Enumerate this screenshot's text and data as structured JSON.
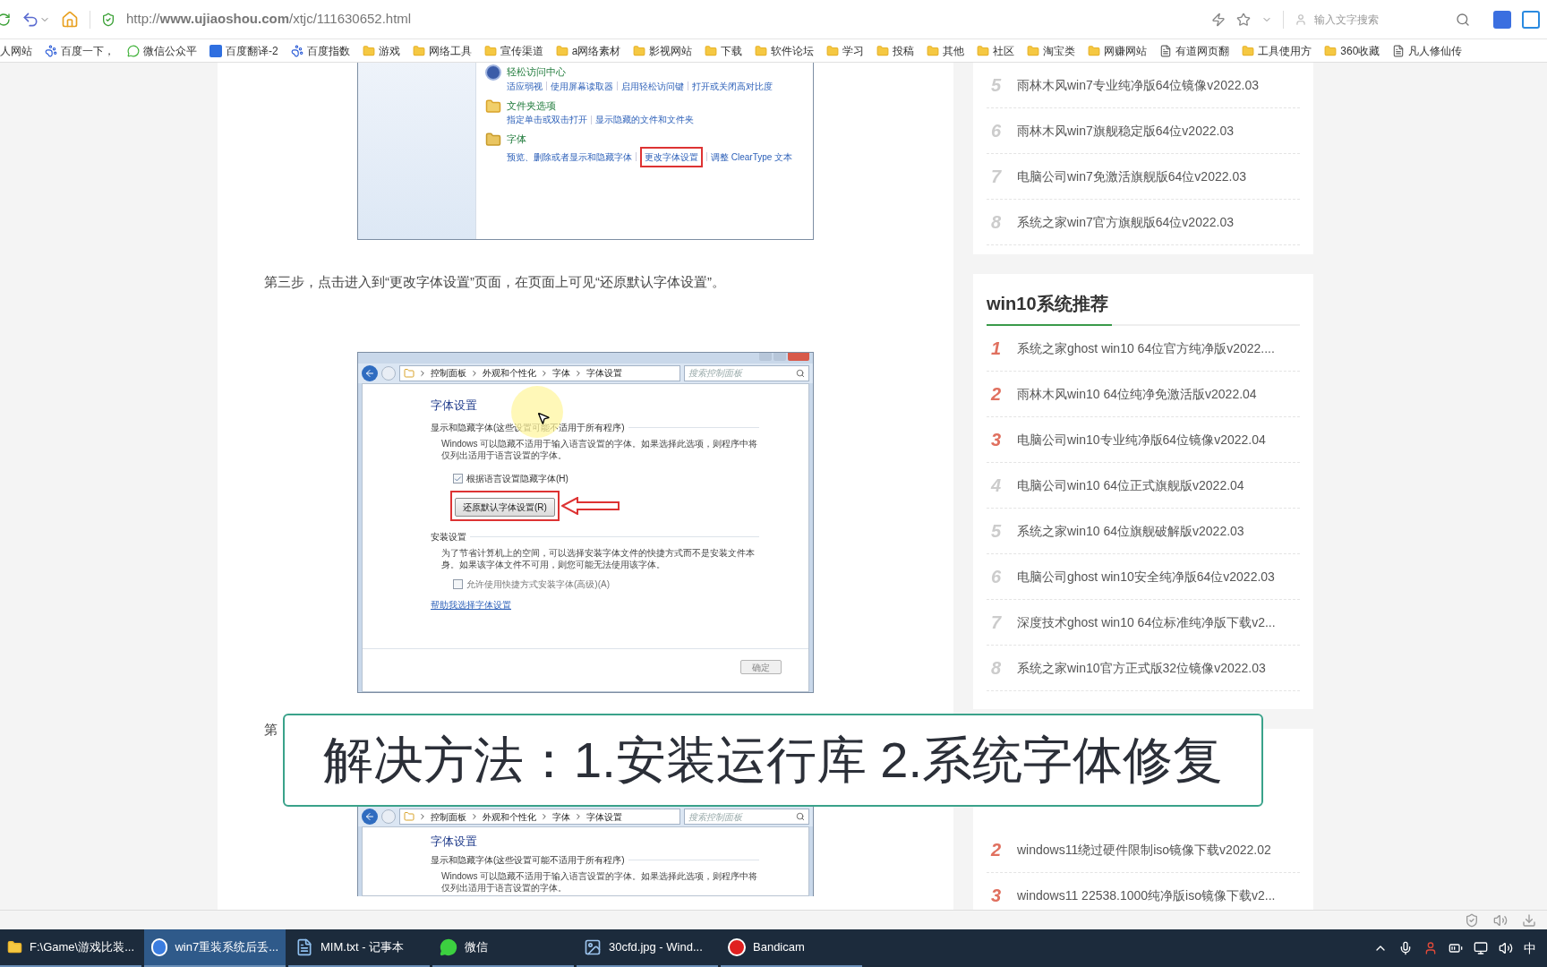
{
  "browser": {
    "url": "http://**www.ujiaoshou.com**/xtjc/111630652.html",
    "search_placeholder": "输入文字搜索"
  },
  "bookmarks": [
    {
      "label": "人网站",
      "kind": "none"
    },
    {
      "label": "百度一下，",
      "kind": "paw"
    },
    {
      "label": "微信公众平",
      "kind": "wechat"
    },
    {
      "label": "百度翻译-2",
      "kind": "translate"
    },
    {
      "label": "百度指数",
      "kind": "paw"
    },
    {
      "label": "游戏",
      "kind": "folder"
    },
    {
      "label": "网络工具",
      "kind": "folder"
    },
    {
      "label": "宣传渠道",
      "kind": "folder"
    },
    {
      "label": "a网络素材",
      "kind": "folder"
    },
    {
      "label": "影视网站",
      "kind": "folder"
    },
    {
      "label": "下载",
      "kind": "folder"
    },
    {
      "label": "软件论坛",
      "kind": "folder"
    },
    {
      "label": "学习",
      "kind": "folder"
    },
    {
      "label": "投稿",
      "kind": "folder"
    },
    {
      "label": "其他",
      "kind": "folder"
    },
    {
      "label": "社区",
      "kind": "folder"
    },
    {
      "label": "淘宝类",
      "kind": "folder"
    },
    {
      "label": "网赚网站",
      "kind": "folder"
    },
    {
      "label": "有道网页翻",
      "kind": "page"
    },
    {
      "label": "工具使用方",
      "kind": "folder"
    },
    {
      "label": "360收藏",
      "kind": "folder"
    },
    {
      "label": "凡人修仙传",
      "kind": "page"
    }
  ],
  "article": [
    {
      "kind": "control_panel",
      "items": [
        {
          "title": "轻松访问中心",
          "kind": "access",
          "links": [
            {
              "text": "适应弱视",
              "highlighted": false
            },
            {
              "text": "使用屏幕读取器",
              "highlighted": false
            },
            {
              "text": "启用轻松访问键",
              "highlighted": false
            },
            {
              "text": "打开或关闭高对比度",
              "highlighted": false
            }
          ]
        },
        {
          "title": "文件夹选项",
          "kind": "folder",
          "links": [
            {
              "text": "指定单击或双击打开",
              "highlighted": false
            },
            {
              "text": "显示隐藏的文件和文件夹",
              "highlighted": false
            }
          ]
        },
        {
          "title": "字体",
          "kind": "font",
          "links": [
            {
              "text": "预览、删除或者显示和隐藏字体",
              "highlighted": false
            },
            {
              "text": "更改字体设置",
              "highlighted": true
            },
            {
              "text": "调整 ClearType 文本",
              "highlighted": false
            }
          ]
        }
      ]
    },
    {
      "kind": "paragraph",
      "text": "第三步，点击进入到“更改字体设置”页面，在页面上可见“还原默认字体设置”。"
    },
    {
      "kind": "font_settings",
      "breadcrumb": [
        "控制面板",
        "外观和个性化",
        "字体",
        "字体设置"
      ],
      "search_placeholder": "搜索控制面板",
      "heading": "字体设置",
      "section1": "显示和隐藏字体(这些设置可能不适用于所有程序)",
      "description": "Windows 可以隐藏不适用于输入语言设置的字体。如果选择此选项，则程序中将仅列出适用于语言设置的字体。",
      "checkbox1": {
        "label": "根据语言设置隐藏字体(H)",
        "checked": true
      },
      "restore_button": {
        "label": "还原默认字体设置(R)",
        "highlighted": true
      },
      "section2": "安装设置",
      "install_text": "为了节省计算机上的空间，可以选择安装字体文件的快捷方式而不是安装文件本身。如果该字体文件不可用，则您可能无法使用该字体。",
      "checkbox2": {
        "label": "允许使用快捷方式安装字体(高级)(A)",
        "checked": false
      },
      "help_link": "帮助我选择字体设置",
      "ok_button": "确定",
      "cursor": true
    },
    {
      "kind": "paragraph_hidden",
      "text": "第"
    },
    {
      "kind": "font_settings_top",
      "breadcrumb": [
        "控制面板",
        "外观和个性化",
        "字体",
        "字体设置"
      ],
      "search_placeholder": "搜索控制面板",
      "heading": "字体设置",
      "section1": "显示和隐藏字体(这些设置可能不适用于所有程序)",
      "description": "Windows 可以隐藏不适用于输入语言设置的字体。如果选择此选项，则程序中将仅列出适用于语言设置的字体。"
    }
  ],
  "sidebar": [
    {
      "items": [
        {
          "rank": "5",
          "text": "雨林木风win7专业纯净版64位镜像v2022.03",
          "color": "#cccccc"
        },
        {
          "rank": "6",
          "text": "雨林木风win7旗舰稳定版64位v2022.03",
          "color": "#cccccc"
        },
        {
          "rank": "7",
          "text": "电脑公司win7免激活旗舰版64位v2022.03",
          "color": "#cccccc"
        },
        {
          "rank": "8",
          "text": "系统之家win7官方旗舰版64位v2022.03",
          "color": "#cccccc"
        }
      ]
    },
    {
      "title": "win10系统推荐",
      "items": [
        {
          "rank": "1",
          "text": "系统之家ghost win10 64位官方纯净版v2022....",
          "color": "#e0705f"
        },
        {
          "rank": "2",
          "text": "雨林木风win10 64位纯净免激活版v2022.04",
          "color": "#e0705f"
        },
        {
          "rank": "3",
          "text": "电脑公司win10专业纯净版64位镜像v2022.04",
          "color": "#e0705f"
        },
        {
          "rank": "4",
          "text": "电脑公司win10 64位正式旗舰版v2022.04",
          "color": "#cccccc"
        },
        {
          "rank": "5",
          "text": "系统之家win10 64位旗舰破解版v2022.03",
          "color": "#cccccc"
        },
        {
          "rank": "6",
          "text": "电脑公司ghost win10安全纯净版64位v2022.03",
          "color": "#cccccc"
        },
        {
          "rank": "7",
          "text": "深度技术ghost win10 64位标准纯净版下载v2...",
          "color": "#cccccc"
        },
        {
          "rank": "8",
          "text": "系统之家win10官方正式版32位镜像v2022.03",
          "color": "#cccccc"
        }
      ]
    },
    {
      "items": [
        {
          "rank": "2",
          "text": "windows11绕过硬件限制iso镜像下载v2022.02",
          "color": "#e0705f"
        },
        {
          "rank": "3",
          "text": "windows11 22538.1000纯净版iso镜像下载v2...",
          "color": "#e0705f"
        }
      ]
    }
  ],
  "caption": "解决方法：1.安装运行库 2.系统字体修复",
  "taskbar": {
    "items": [
      {
        "label": "F:\\Game\\游戏比装...",
        "kind": "folder",
        "selected": false
      },
      {
        "label": "win7重装系统后丢...",
        "kind": "sogou",
        "selected": true
      },
      {
        "label": "MIM.txt - 记事本",
        "kind": "notepad",
        "selected": false
      },
      {
        "label": "微信",
        "kind": "wechat",
        "selected": false
      },
      {
        "label": "30cfd.jpg - Wind...",
        "kind": "image",
        "selected": false
      },
      {
        "label": "Bandicam",
        "kind": "record",
        "selected": false
      }
    ],
    "ime": "中"
  }
}
